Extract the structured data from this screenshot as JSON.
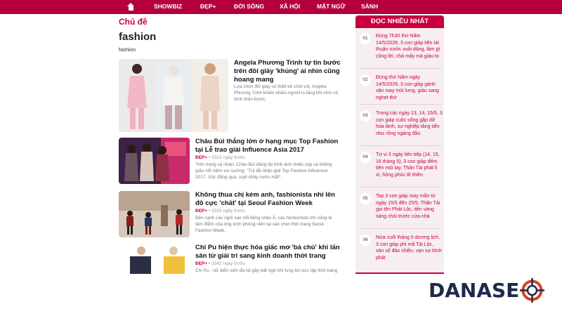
{
  "nav": {
    "home_icon": "home-icon",
    "items": [
      "SHOWBIZ",
      "ĐẸP+",
      "ĐỜI SỐNG",
      "XÃ HỘI",
      "MẶT NGỮ",
      "SÀNH"
    ]
  },
  "topic_label": "Chủ đề",
  "tag": {
    "title": "fashion",
    "subtitle": "fashion"
  },
  "articles": [
    {
      "title": "Angela Phương Trinh tự tin bước trên đôi giày 'khủng' ai nhìn cũng hoang mang",
      "desc": "Lựa chọn đôi giày có thiết kế chót vót, Angela Phương Trinh khiến nhiều người lo lắng khi nhìn cô bình thản bước."
    },
    {
      "title": "Châu Bùi thắng lớn ở hạng mục Top Fashion tại Lễ trao giải Influence Asia 2017",
      "category": "ĐẸP+",
      "meta": "3322 ngày trước",
      "desc": "Trên trang cá nhân, Châu Bùi đăng tải hình ảnh chiếc cúp và không giấu nổi niềm vui sướng: \"Tui đã nhận giải Top Fashion Influencer 2017. Xúc động quá, suýt chảy nước mắt\"."
    },
    {
      "title": "Không thua chị kém anh, fashionista nhí lên đồ cực 'chất' tại Seoul Fashion Week",
      "category": "ĐẸP+",
      "meta": "3333 ngày trước",
      "desc": "Bên cạnh các ngôi sao nổi tiếng châu Á, các fashionista nhí cũng là tâm điểm của ống kính phóng viên tại sàn chơi thời trang Seoul Fashion Week."
    },
    {
      "title": "Chi Pu hiện thực hóa giấc mơ 'bà chủ' khi lấn sân từ giải trí sang kinh doanh thời trang",
      "category": "ĐẸP+",
      "meta": "3342 ngày trước",
      "desc": "Chi Pu - nữ diễn viên đa tài gây bất ngờ khi tung bộ sưu tập thời trang tự sản"
    }
  ],
  "sidebar": {
    "title": "ĐỌC NHIỀU NHẤT",
    "items": [
      {
        "num": "01",
        "text": "Đúng 7h30 thứ Năm 14/5/2026, 3 con giáp tiền tài thuận nước xuôi dòng, làm gì cũng lời, chả mấy mà giàu to"
      },
      {
        "num": "02",
        "text": "Đúng thứ Năm ngày 14/5/2026, 3 con giáp gánh vận may mỏi lưng, giàu sang nghẹt thở"
      },
      {
        "num": "03",
        "text": "Trong các ngày 13, 14, 15/5, 3 con giáp cuộc sống gặp dữ hóa lành, sự nghiệp tăng tiến như rồng ngàng đầu"
      },
      {
        "num": "04",
        "text": "Từ vi 3 ngày liên tiếp (14, 15, 16 tháng 5), 3 con giáp đếm tiền mỏi tay, Thần Tài phát lì xì, hồng phúc tề thiên"
      },
      {
        "num": "05",
        "text": "Top 3 con giáp may mắn từ ngày 15/5 đến 25/5, Thần Tài gọi tên Phát Lộc, tiền vàng sáng chói trước cửa nhà"
      },
      {
        "num": "06",
        "text": "Nửa cuối tháng 5 dương lịch, 3 con giáp phi mã Tài Lộc, vàn số đảo chiều, vạn sự khởi phát"
      }
    ]
  },
  "brand": {
    "text": "DANASE",
    "logo": "crosshair-o-logo"
  },
  "colors": {
    "accent": "#c8003e",
    "nav": "#b5003b",
    "sidebar_bg": "#f7eef0",
    "brand_navy": "#1d2a4a",
    "brand_red": "#d64524"
  }
}
